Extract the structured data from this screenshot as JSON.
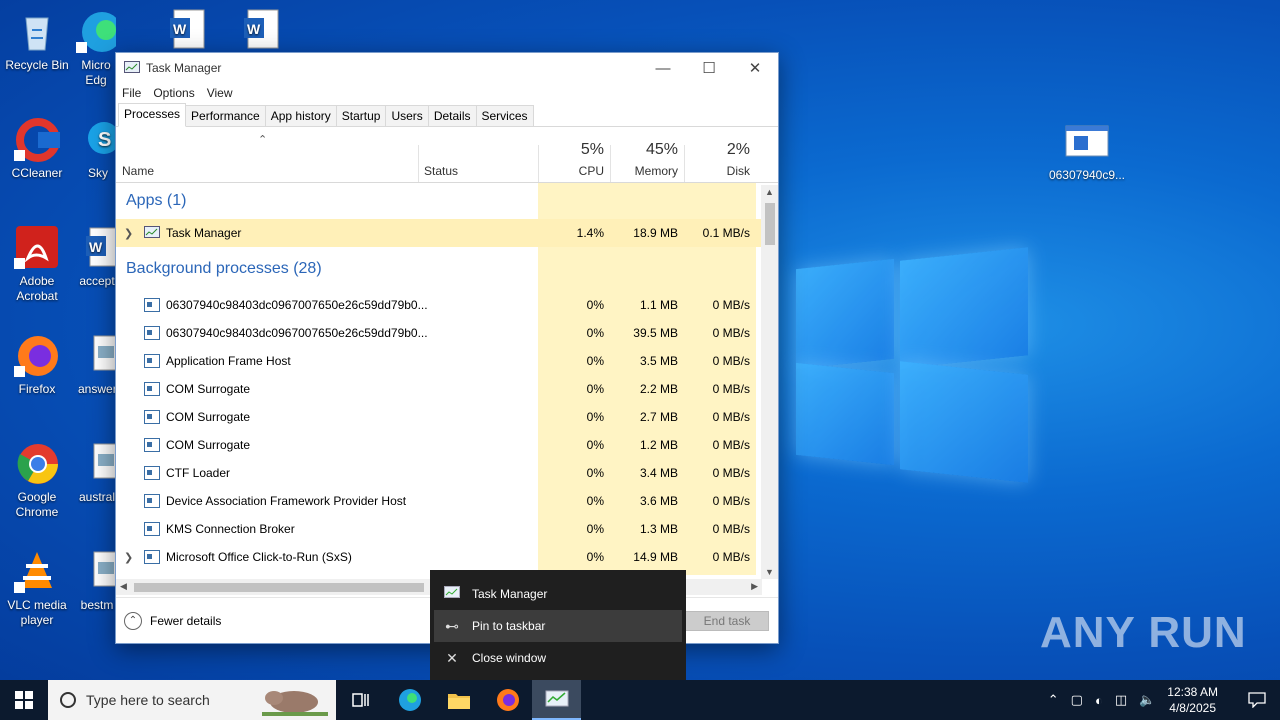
{
  "desktop": {
    "icons": [
      {
        "label": "Recycle Bin",
        "icon": "recycle-bin-icon"
      },
      {
        "label": "Micro Edg",
        "icon": "edge-icon"
      },
      {
        "label": "CCleaner",
        "icon": "ccleaner-icon"
      },
      {
        "label": "Sky",
        "icon": "skype-icon"
      },
      {
        "label": "Adobe Acrobat",
        "icon": "acrobat-icon"
      },
      {
        "label": "accept",
        "icon": "word-doc-icon"
      },
      {
        "label": "Firefox",
        "icon": "firefox-icon"
      },
      {
        "label": "answer",
        "icon": "image-file-icon"
      },
      {
        "label": "Google Chrome",
        "icon": "chrome-icon"
      },
      {
        "label": "austral",
        "icon": "image-file-icon"
      },
      {
        "label": "VLC media player",
        "icon": "vlc-icon"
      },
      {
        "label": "bestm",
        "icon": "image-file-icon"
      },
      {
        "label": "06307940c9...",
        "icon": "executable-icon"
      }
    ]
  },
  "taskmanager": {
    "title": "Task Manager",
    "menu": [
      "File",
      "Options",
      "View"
    ],
    "tabs": [
      "Processes",
      "Performance",
      "App history",
      "Startup",
      "Users",
      "Details",
      "Services"
    ],
    "columns": {
      "name": "Name",
      "status": "Status",
      "cpu_pct": "5%",
      "cpu": "CPU",
      "mem_pct": "45%",
      "mem": "Memory",
      "disk_pct": "2%",
      "disk": "Disk"
    },
    "apps_group": "Apps (1)",
    "apps": [
      {
        "name": "Task Manager",
        "cpu": "1.4%",
        "mem": "18.9 MB",
        "disk": "0.1 MB/s",
        "expand": true
      }
    ],
    "bg_group": "Background processes (28)",
    "background": [
      {
        "name": "06307940c98403dc0967007650e26c59dd79b0...",
        "cpu": "0%",
        "mem": "1.1 MB",
        "disk": "0 MB/s"
      },
      {
        "name": "06307940c98403dc0967007650e26c59dd79b0...",
        "cpu": "0%",
        "mem": "39.5 MB",
        "disk": "0 MB/s"
      },
      {
        "name": "Application Frame Host",
        "cpu": "0%",
        "mem": "3.5 MB",
        "disk": "0 MB/s"
      },
      {
        "name": "COM Surrogate",
        "cpu": "0%",
        "mem": "2.2 MB",
        "disk": "0 MB/s"
      },
      {
        "name": "COM Surrogate",
        "cpu": "0%",
        "mem": "2.7 MB",
        "disk": "0 MB/s"
      },
      {
        "name": "COM Surrogate",
        "cpu": "0%",
        "mem": "1.2 MB",
        "disk": "0 MB/s"
      },
      {
        "name": "CTF Loader",
        "cpu": "0%",
        "mem": "3.4 MB",
        "disk": "0 MB/s"
      },
      {
        "name": "Device Association Framework Provider Host",
        "cpu": "0%",
        "mem": "3.6 MB",
        "disk": "0 MB/s"
      },
      {
        "name": "KMS Connection Broker",
        "cpu": "0%",
        "mem": "1.3 MB",
        "disk": "0 MB/s"
      },
      {
        "name": "Microsoft Office Click-to-Run (SxS)",
        "cpu": "0%",
        "mem": "14.9 MB",
        "disk": "0 MB/s"
      }
    ],
    "fewer_details": "Fewer details",
    "end_task": "End task"
  },
  "jumplist": {
    "items": [
      {
        "label": "Task Manager",
        "icon": "task-manager-icon"
      },
      {
        "label": "Pin to taskbar",
        "icon": "pin-icon"
      },
      {
        "label": "Close window",
        "icon": "close-icon"
      }
    ]
  },
  "taskbar": {
    "search_placeholder": "Type here to search",
    "time": "12:38 AM",
    "date": "4/8/2025"
  },
  "watermark": "ANY RUN"
}
